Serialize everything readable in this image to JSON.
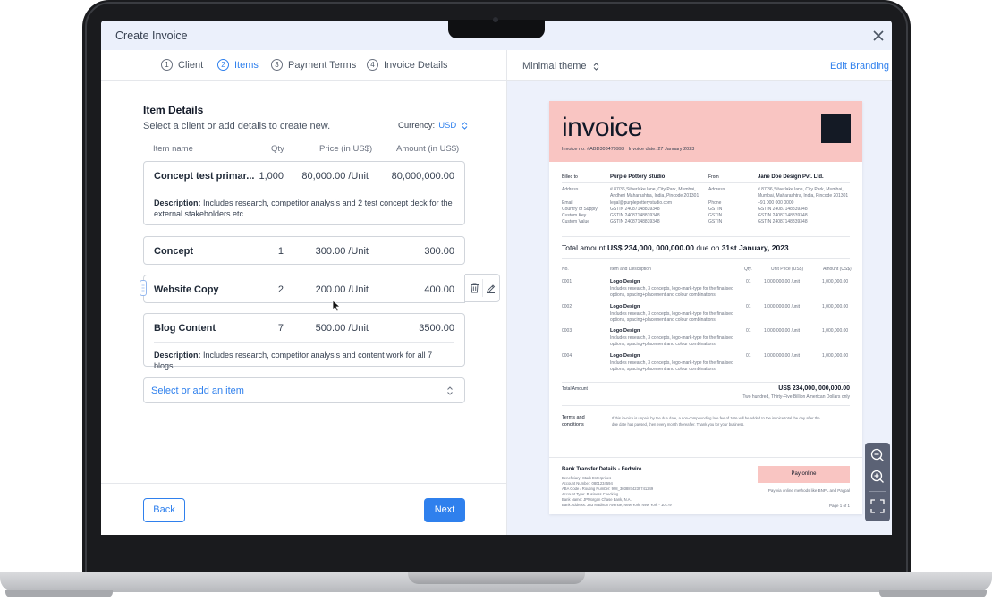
{
  "window": {
    "title": "Create Invoice"
  },
  "steps": [
    {
      "num": "1",
      "label": "Client"
    },
    {
      "num": "2",
      "label": "Items"
    },
    {
      "num": "3",
      "label": "Payment Terms"
    },
    {
      "num": "4",
      "label": "Invoice Details"
    }
  ],
  "items_section": {
    "title": "Item Details",
    "subtitle": "Select a client or add details to create new.",
    "currency_label": "Currency:",
    "currency_value": "USD",
    "columns": {
      "name": "Item name",
      "qty": "Qty",
      "price": "Price (in US$)",
      "amount": "Amount (in US$)"
    }
  },
  "items": [
    {
      "name": "Concept test primar...",
      "qty": "1,000",
      "price": "80,000.00 /Unit",
      "amount": "80,000,000.00",
      "desc_label": "Description:",
      "desc": "Includes research, competitor analysis and 2 test concept deck for the external stakeholders etc."
    },
    {
      "name": "Concept",
      "qty": "1",
      "price": "300.00 /Unit",
      "amount": "300.00"
    },
    {
      "name": "Website Copy",
      "qty": "2",
      "price": "200.00 /Unit",
      "amount": "400.00"
    },
    {
      "name": "Blog Content",
      "qty": "7",
      "price": "500.00 /Unit",
      "amount": "3500.00",
      "desc_label": "Description:",
      "desc": "Includes research, competitor analysis and content work for all 7 blogs."
    }
  ],
  "select_item": {
    "placeholder": "Select or add an item"
  },
  "footer": {
    "back": "Back",
    "next": "Next"
  },
  "preview": {
    "theme": "Minimal theme",
    "edit_branding": "Edit Branding",
    "invoice": {
      "title": "invoice",
      "invoice_no": "Invoice no: #ABD303479993",
      "invoice_date": "Invoice date: 27 January 2023",
      "billed_to_label": "Billed to",
      "billed_to": "Purple Pottery Studio",
      "from_label": "From",
      "from": "Jane Doe Design Pvt. Ltd.",
      "bill_fields": [
        "Address",
        "Email",
        "Country of Supply",
        "Custom Key",
        "Custom Value"
      ],
      "bill_values": [
        "#.87/36,Silverlake lane, City Park, Mumbai,",
        "Andheri Maharashtra, India, Pincode 201301",
        "legal@purplepotterystudio.com",
        "GSTIN 24087148839348",
        "GSTIN 24087148839348",
        "GSTIN 24087148839348"
      ],
      "from_fields": [
        "Address",
        "Phone",
        "GSTIN",
        "GSTIN",
        "GSTIN"
      ],
      "from_values": [
        "#.87/36,Silverlake lane, City Park, Mumbai,",
        "Mumbai, Maharashtra, India, Pincode 201301",
        "+91 000 000 0000",
        "GSTIN 24087148839348",
        "GSTIN 24087148839348",
        "GSTIN 24087148839348"
      ],
      "total_prefix": "Total amount",
      "total_value": "US$ 234,000, 000,000.00",
      "total_due": "due on",
      "total_date": "31st January, 2023",
      "table_cols": {
        "no": "No.",
        "item": "Item and Description",
        "qty": "Qty.",
        "unit": "Unit Price (US$)",
        "amount": "Amount (US$)"
      },
      "rows": [
        {
          "no": "0001",
          "item": "Logo Design",
          "desc1": "Includes research, 3 concepts, logo-mark-type for the finalised",
          "desc2": "options, spacing+placement and colour combinations.",
          "qty": "01",
          "unit": "1,000,000.00 /unit",
          "amount": "1,000,000.00"
        },
        {
          "no": "0002",
          "item": "Logo Design",
          "desc1": "Includes research, 3 concepts, logo-mark-type for the finalised",
          "desc2": "options, spacing+placement and colour combinations.",
          "qty": "01",
          "unit": "1,000,000.00 /unit",
          "amount": "1,000,000.00"
        },
        {
          "no": "0003",
          "item": "Logo Design",
          "desc1": "Includes research, 3 concepts, logo-mark-type for the finalised",
          "desc2": "options, spacing+placement and colour combinations.",
          "qty": "01",
          "unit": "1,000,000.00 /unit",
          "amount": "1,000,000.00"
        },
        {
          "no": "0004",
          "item": "Logo Design",
          "desc1": "Includes research, 3 concepts, logo-mark-type for the finalised",
          "desc2": "options, spacing+placement and colour combinations.",
          "qty": "01",
          "unit": "1,000,000.00 /unit",
          "amount": "1,000,000.00"
        }
      ],
      "total_amount_label": "Total Amount",
      "total_amount_value": "US$ 234,000, 000,000.00",
      "total_words": "Two hundred, Thirty-Five Billion American Dollars only",
      "terms_label_1": "Terms and",
      "terms_label_2": "conditions",
      "terms_1": "If this invoice is unpaid by the due date, a non-compounding late fee of 10% will be added to the invoice total the day after the",
      "terms_2": "due date has passed, then every month thereafter. Thank you for your business.",
      "bank_title": "Bank Transfer Details - Fedwire",
      "bank_lines": [
        "Beneficiary: Stark Enterprises",
        "Account Number: 0801234594",
        "ABA Code / Routing Number: 998_3038874239741249",
        "Account Type: Business Checking",
        "Bank Name: JPMorgan Chase Bank, N.A.",
        "Bank Address: 383 Madison Avenue, New York, New York - 10179"
      ],
      "pay_online": "Pay online",
      "pay_methods": "Pay via online methods like BNPL and Paypal",
      "page": "Page 1 of 1"
    }
  },
  "colors": {
    "accent": "#2f80ed",
    "invoice_header": "#f9c5c2",
    "preview_bg": "#edf1fb"
  }
}
